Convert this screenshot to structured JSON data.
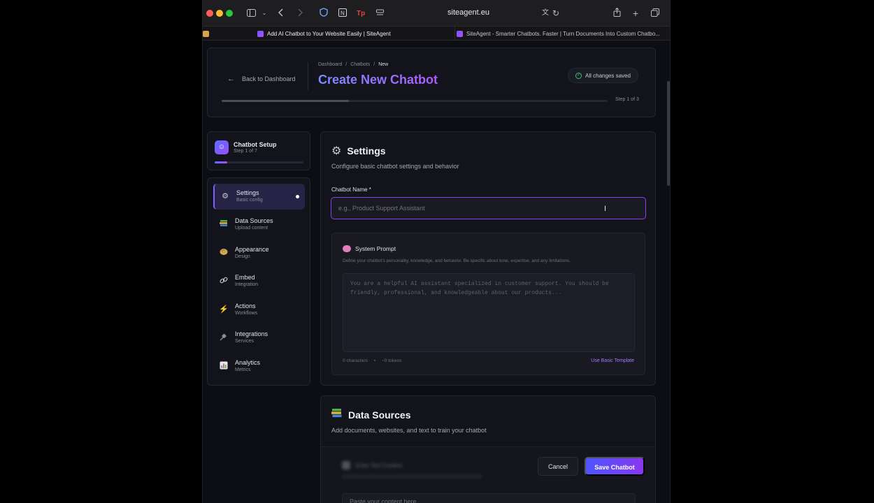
{
  "browser": {
    "url": "siteagent.eu",
    "tabs": [
      {
        "label": "Add AI Chatbot to Your Website Easily | SiteAgent",
        "active": true
      },
      {
        "label": "SiteAgent - Smarter Chatbots. Faster | Turn Documents Into Custom Chatbo...",
        "active": false
      }
    ],
    "icons": [
      "sidebar-toggle-icon",
      "back-icon",
      "forward-icon",
      "shield-icon",
      "notion-icon",
      "tp-icon",
      "page-settings-icon",
      "translate-icon",
      "reload-icon",
      "share-icon",
      "new-tab-icon",
      "tab-overview-icon"
    ]
  },
  "header": {
    "back_label": "Back to Dashboard",
    "breadcrumb": [
      "Dashboard",
      "/",
      "Chatbots",
      "/",
      "New"
    ],
    "title": "Create New Chatbot",
    "saved_label": "All changes saved",
    "step_label": "Step 1 of 3",
    "progress": 0.33
  },
  "setup": {
    "title": "Chatbot Setup",
    "subtitle": "Step 1 of 7",
    "progress": 0.14
  },
  "nav": [
    {
      "label": "Settings",
      "sub": "Basic config",
      "icon": "gear-icon",
      "active": true
    },
    {
      "label": "Data Sources",
      "sub": "Upload content",
      "icon": "books-icon",
      "active": false
    },
    {
      "label": "Appearance",
      "sub": "Design",
      "icon": "palette-icon",
      "active": false
    },
    {
      "label": "Embed",
      "sub": "Integration",
      "icon": "link-icon",
      "active": false
    },
    {
      "label": "Actions",
      "sub": "Workflows",
      "icon": "lightning-icon",
      "active": false
    },
    {
      "label": "Integrations",
      "sub": "Services",
      "icon": "plug-icon",
      "active": false
    },
    {
      "label": "Analytics",
      "sub": "Metrics",
      "icon": "chart-icon",
      "active": false
    }
  ],
  "settings": {
    "title": "Settings",
    "description": "Configure basic chatbot settings and behavior",
    "name_label": "Chatbot Name *",
    "name_placeholder": "e.g., Product Support Assistant",
    "name_value": "",
    "prompt_title": "System Prompt",
    "prompt_description": "Define your chatbot's personality, knowledge, and behavior. Be specific about tone, expertise, and any limitations.",
    "prompt_placeholder": "You are a helpful AI assistant specialized in customer support. You should be friendly, professional, and knowledgeable about our products...",
    "char_count": "0 characters",
    "separator": "•",
    "token_count": "~0 tokens",
    "template_link": "Use Basic Template"
  },
  "data_sources": {
    "title": "Data Sources",
    "description": "Add documents, websites, and text to train your chatbot",
    "subsection_title": "Enter Text Content",
    "paste_placeholder": "Paste your content here..."
  },
  "actions": {
    "cancel_label": "Cancel",
    "save_label": "Save Chatbot"
  },
  "colors": {
    "accent": "#8f3ef0",
    "title_gradient_start": "#7d8cff",
    "title_gradient_end": "#b05aff",
    "success": "#39c07a"
  }
}
